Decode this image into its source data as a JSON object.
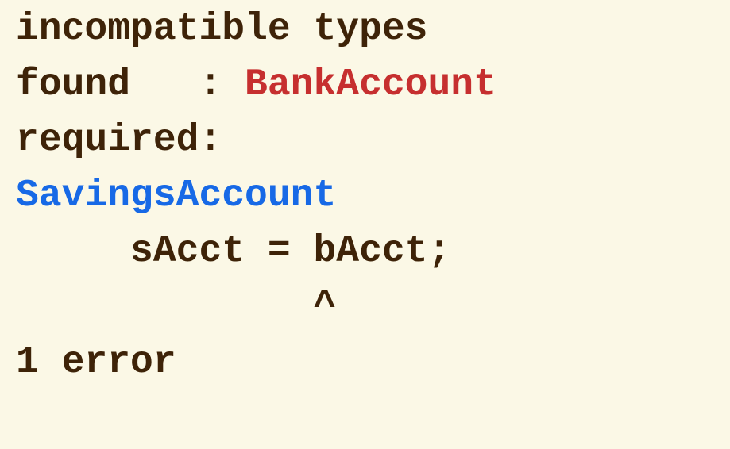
{
  "console": {
    "line1": "incompatible types",
    "found_label": "found   : ",
    "found_type": "BankAccount",
    "required_label": "required:",
    "required_type": "SavingsAccount",
    "code": "     sAcct = bAcct;",
    "caret": "             ^",
    "error_count": "1 error"
  },
  "colors": {
    "background": "#fbf8e6",
    "text": "#3e2308",
    "found_type": "#c62f2f",
    "required_type": "#1769e6"
  }
}
